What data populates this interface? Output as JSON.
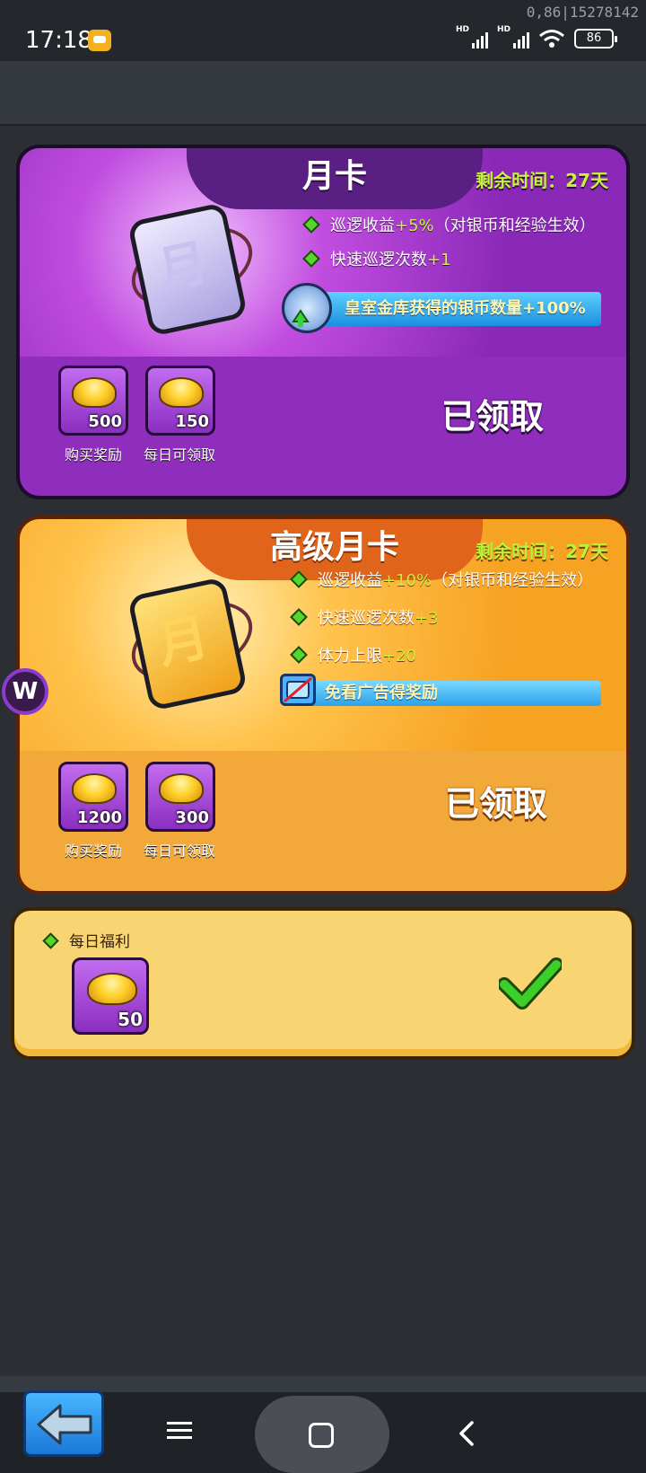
{
  "status_bar": {
    "time": "17:18",
    "debug": "0,86|15278142",
    "signal1_label": "HD",
    "signal2_label": "HD",
    "battery": "86"
  },
  "monthly_card": {
    "title": "月卡",
    "remaining_label": "剩余时间：",
    "remaining_value": "27天",
    "benefits": [
      {
        "text": "巡逻收益",
        "highlight": "+5%",
        "suffix": "（对银币和经验生效）"
      },
      {
        "text": "快速巡逻次数",
        "highlight": "+1",
        "suffix": ""
      }
    ],
    "banner": "皇室金库获得的银币数量+100%",
    "rewards": [
      {
        "amount": "500",
        "label": "购买奖励"
      },
      {
        "amount": "150",
        "label": "每日可领取"
      }
    ],
    "status": "已领取"
  },
  "premium_card": {
    "title": "高级月卡",
    "remaining_label": "剩余时间：",
    "remaining_value": "27天",
    "benefits": [
      {
        "text": "巡逻收益",
        "highlight": "+10%",
        "suffix": "（对银币和经验生效）"
      },
      {
        "text": "快速巡逻次数",
        "highlight": "+3",
        "suffix": ""
      },
      {
        "text": "体力上限",
        "highlight": "+20",
        "suffix": ""
      }
    ],
    "banner": "免看广告得奖励",
    "rewards": [
      {
        "amount": "1200",
        "label": "购买奖励"
      },
      {
        "amount": "300",
        "label": "每日可领取"
      }
    ],
    "status": "已领取"
  },
  "daily_welfare": {
    "label": "每日福利",
    "amount": "50"
  },
  "floating_button": "W",
  "colors": {
    "purple_card": "#8f2dbd",
    "orange_card": "#f3a83a",
    "highlight_green": "#c6f23a",
    "check_green": "#3ccf2a"
  }
}
